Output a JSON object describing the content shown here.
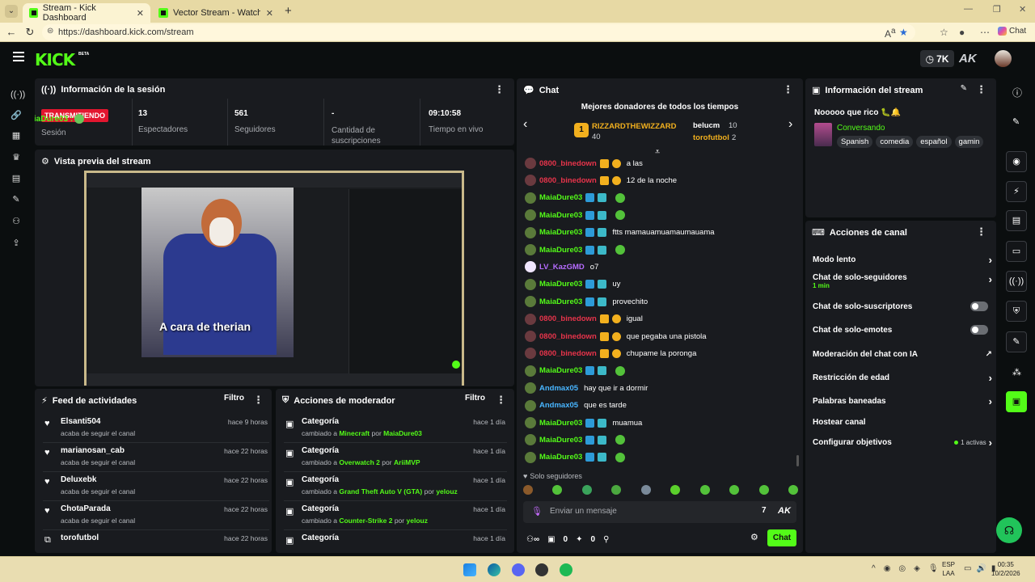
{
  "browser": {
    "tabs": [
      {
        "title": "Stream - Kick Dashboard"
      },
      {
        "title": "Vector Stream - Watch Live o"
      }
    ],
    "url": "https://dashboard.kick.com/stream",
    "chat_button": "Chat"
  },
  "header": {
    "logo": "KICK",
    "beta": "BETA",
    "viewer_pill": "7K",
    "ak_label": "AK"
  },
  "session": {
    "title": "Información de la sesión",
    "live_badge": "TRANSMITIENDO",
    "overlay_user": "MaiaDure03 :",
    "stats": [
      {
        "value": "",
        "label": "Sesión"
      },
      {
        "value": "13",
        "label": "Espectadores"
      },
      {
        "value": "561",
        "label": "Seguidores"
      },
      {
        "value": "-",
        "label": "Cantidad de suscripciones"
      },
      {
        "value": "09:10:58",
        "label": "Tiempo en vivo"
      }
    ]
  },
  "preview": {
    "title": "Vista previa del stream",
    "caption": "A cara de therian"
  },
  "activity": {
    "title": "Feed de actividades",
    "filter": "Filtro",
    "items": [
      {
        "name": "Elsanti504",
        "sub": "acaba de seguir el canal",
        "time": "hace 9 horas"
      },
      {
        "name": "marianosan_cab",
        "sub": "acaba de seguir el canal",
        "time": "hace 22 horas"
      },
      {
        "name": "Deluxebk",
        "sub": "acaba de seguir el canal",
        "time": "hace 22 horas"
      },
      {
        "name": "ChotaParada",
        "sub": "acaba de seguir el canal",
        "time": "hace 22 horas"
      },
      {
        "name": "torofutbol",
        "sub": "",
        "time": "hace 22 horas"
      }
    ]
  },
  "mod_actions": {
    "title": "Acciones de moderador",
    "filter": "Filtro",
    "items": [
      {
        "name": "Categoría",
        "pre": "cambiado a",
        "cat": "Minecraft",
        "por": "por",
        "user": "MaiaDure03",
        "time": "hace 1 día"
      },
      {
        "name": "Categoría",
        "pre": "cambiado a",
        "cat": "Overwatch 2",
        "por": "por",
        "user": "AriiMVP",
        "time": "hace 1 día"
      },
      {
        "name": "Categoría",
        "pre": "cambiado a",
        "cat": "Grand Theft Auto V (GTA)",
        "por": "por",
        "user": "yelouz",
        "time": "hace 1 día"
      },
      {
        "name": "Categoría",
        "pre": "cambiado a",
        "cat": "Counter-Strike 2",
        "por": "por",
        "user": "yelouz",
        "time": "hace 1 día"
      },
      {
        "name": "Categoría",
        "pre": "",
        "cat": "",
        "por": "",
        "user": "",
        "time": "hace 1 día"
      }
    ]
  },
  "chat": {
    "title": "Chat",
    "donors_title": "Mejores donadores de todos los tiempos",
    "top_donor": {
      "name": "RIZZARDTHEWIZZARD",
      "amount": "40",
      "rank": "1"
    },
    "donor2": {
      "name": "belucm",
      "amount": "10"
    },
    "donor3": {
      "name": "torofutbol",
      "amount": "2"
    },
    "messages": [
      {
        "user": "0800_binedown",
        "text": "a las",
        "color": "#e8344b"
      },
      {
        "user": "0800_binedown",
        "text": "12 de la noche",
        "color": "#e8344b"
      },
      {
        "user": "MaiaDure03",
        "text": "",
        "color": "#53fc18"
      },
      {
        "user": "MaiaDure03",
        "text": "",
        "color": "#53fc18"
      },
      {
        "user": "MaiaDure03",
        "text": "ftts mamauamuamaumauama",
        "color": "#53fc18"
      },
      {
        "user": "MaiaDure03",
        "text": "",
        "color": "#53fc18"
      },
      {
        "user": "LV_KazGMD",
        "text": "o7",
        "color": "#b66cff"
      },
      {
        "user": "MaiaDure03",
        "text": "uy",
        "color": "#53fc18"
      },
      {
        "user": "MaiaDure03",
        "text": "provechito",
        "color": "#53fc18"
      },
      {
        "user": "0800_binedown",
        "text": "igual",
        "color": "#e8344b"
      },
      {
        "user": "0800_binedown",
        "text": "que pegaba una pistola",
        "color": "#e8344b"
      },
      {
        "user": "0800_binedown",
        "text": "chupame la poronga",
        "color": "#e8344b"
      },
      {
        "user": "MaiaDure03",
        "text": "",
        "color": "#53fc18"
      },
      {
        "user": "Andmax05",
        "text": "hay que ir a dormir",
        "color": "#48b5ff"
      },
      {
        "user": "Andmax05",
        "text": "que es tarde",
        "color": "#48b5ff"
      },
      {
        "user": "MaiaDure03",
        "text": "muamua",
        "color": "#53fc18"
      },
      {
        "user": "MaiaDure03",
        "text": "",
        "color": "#53fc18"
      },
      {
        "user": "MaiaDure03",
        "text": "",
        "color": "#53fc18"
      }
    ],
    "followers_only": "Solo seguidores",
    "input_placeholder": "Enviar un mensaje",
    "footer_count1": "0",
    "footer_count2": "0",
    "send_button": "Chat",
    "ak": "AK"
  },
  "stream_info": {
    "title": "Información del stream",
    "stream_title": "Nooooo que rico",
    "category": "Conversando",
    "tags": [
      "Spanish",
      "comedia",
      "español",
      "gamin"
    ]
  },
  "channel_actions": {
    "title": "Acciones de canal",
    "items": [
      {
        "label": "Modo lento",
        "sub": "",
        "control": "arrow"
      },
      {
        "label": "Chat de solo-seguidores",
        "sub": "1 min",
        "control": "arrow"
      },
      {
        "label": "Chat de solo-suscriptores",
        "sub": "",
        "control": "toggle"
      },
      {
        "label": "Chat de solo-emotes",
        "sub": "",
        "control": "toggle"
      },
      {
        "label": "Moderación del chat con IA",
        "sub": "",
        "control": "external"
      },
      {
        "label": "Restricción de edad",
        "sub": "",
        "control": "arrow"
      },
      {
        "label": "Palabras baneadas",
        "sub": "",
        "control": "arrow"
      },
      {
        "label": "Hostear canal",
        "sub": "",
        "control": "none"
      },
      {
        "label": "Configurar objetivos",
        "sub": "",
        "control": "arrow"
      }
    ],
    "goals_active": "1 activas"
  },
  "taskbar": {
    "lang": "ESP",
    "lang2": "LAA",
    "time": "00:35",
    "date": "10/2/2026"
  },
  "colors": {
    "accent": "#53fc18",
    "panel": "#191b1f",
    "bg": "#0b0e0f"
  }
}
